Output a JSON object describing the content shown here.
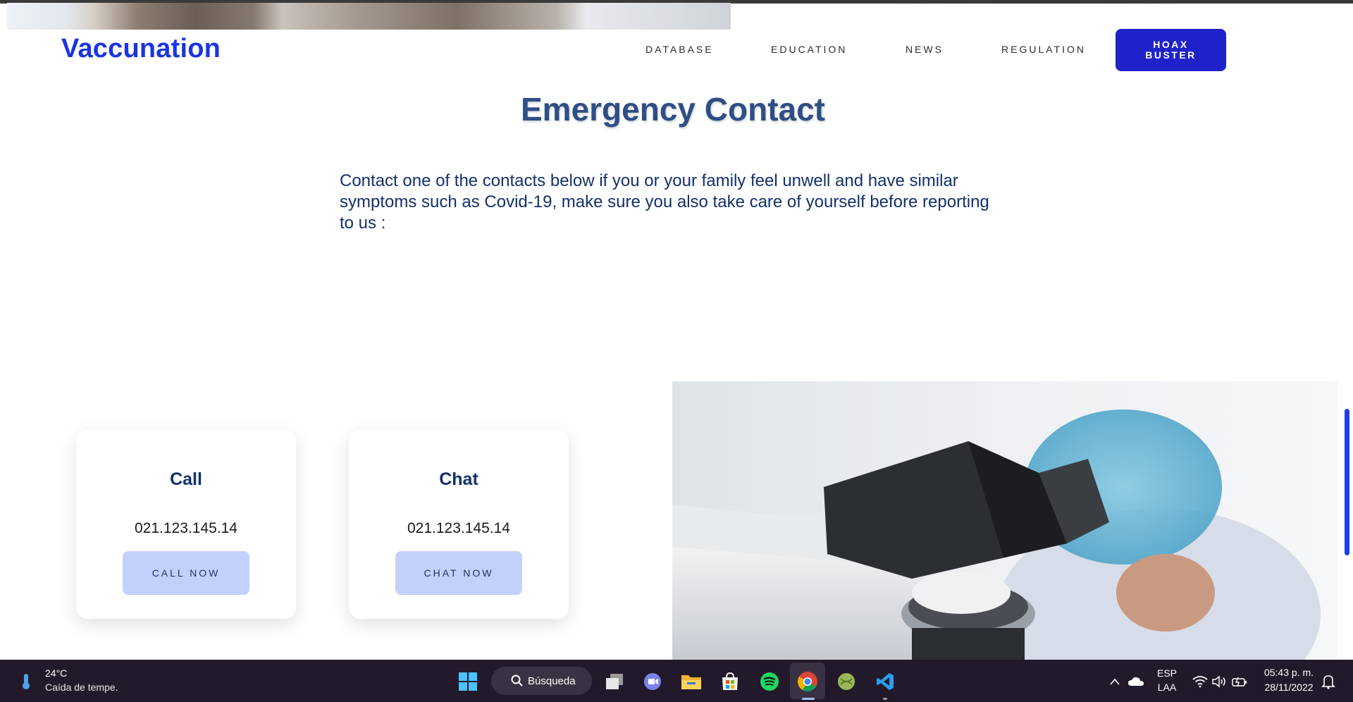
{
  "header": {
    "logo": "Vaccunation",
    "nav": [
      "DATABASE",
      "EDUCATION",
      "NEWS",
      "REGULATION"
    ],
    "cta_label": "HOAX BUSTER"
  },
  "main": {
    "title": "Emergency Contact",
    "intro": "Contact one of the contacts below if you or your family feel unwell and have similar symptoms such as Covid-19, make sure you also take care of yourself before reporting to us :",
    "cards": [
      {
        "title": "Call",
        "phone": "021.123.145.14",
        "button": "CALL NOW"
      },
      {
        "title": "Chat",
        "phone": "021.123.145.14",
        "button": "CHAT NOW"
      }
    ]
  },
  "colors": {
    "brand": "#1a35e0",
    "cta_bg": "#1f22c9",
    "title": "#2e4f86",
    "card_button_bg": "#c3d0fb",
    "taskbar_bg": "#221a2b"
  },
  "taskbar": {
    "weather": {
      "temp": "24°C",
      "desc": "Caída de tempe."
    },
    "search_label": "Búsqueda",
    "apps": [
      "windows-start-icon",
      "task-view-icon",
      "teams-chat-icon",
      "file-explorer-icon",
      "microsoft-store-icon",
      "spotify-icon",
      "chrome-icon",
      "app-icon",
      "vscode-icon"
    ],
    "language": {
      "lang": "ESP",
      "layout": "LAA"
    },
    "time": "05:43 p. m.",
    "date": "28/11/2022"
  }
}
